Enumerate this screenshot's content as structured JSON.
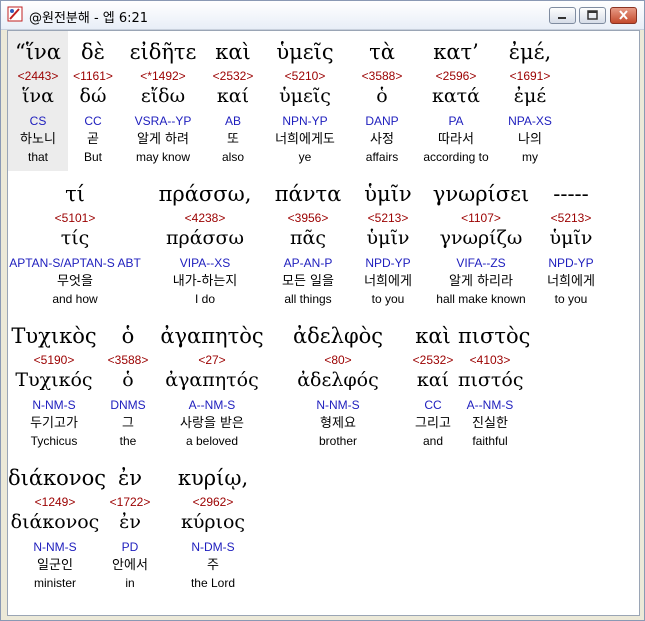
{
  "window": {
    "title": "@원전분해 - 엡 6:21",
    "buttons": {
      "minimize": "minimize",
      "maximize": "maximize",
      "close": "close"
    }
  },
  "rows": [
    [
      {
        "surface": "“ἵνα",
        "strong": "<2443>",
        "lemma": "ἵνα",
        "parse": "CS",
        "korean": "하노니",
        "english": "that",
        "selected": true
      },
      {
        "surface": "δὲ",
        "strong": "<1161>",
        "lemma": "δώ",
        "parse": "CC",
        "korean": "곧",
        "english": "But"
      },
      {
        "surface": "εἰδῆτε",
        "strong": "<*1492>",
        "lemma": "εἴδω",
        "parse": "VSRA--YP",
        "korean": "알게 하려",
        "english": "may know"
      },
      {
        "surface": "καὶ",
        "strong": "<2532>",
        "lemma": "καί",
        "parse": "AB",
        "korean": "또",
        "english": "also"
      },
      {
        "surface": "ὑμεῖς",
        "strong": "<5210>",
        "lemma": "ὑμεῖς",
        "parse": "NPN-YP",
        "korean": "너희에게도",
        "english": "ye"
      },
      {
        "surface": "τὰ",
        "strong": "<3588>",
        "lemma": "ὁ",
        "parse": "DANP",
        "korean": "사정",
        "english": "affairs"
      },
      {
        "surface": "κατ’",
        "strong": "<2596>",
        "lemma": "κατά",
        "parse": "PA",
        "korean": "따라서",
        "english": "according to"
      },
      {
        "surface": "ἐμέ,",
        "strong": "<1691>",
        "lemma": "ἐμέ",
        "parse": "NPA-XS",
        "korean": "나의",
        "english": "my"
      }
    ],
    [
      {
        "surface": "τί",
        "strong": "<5101>",
        "lemma": "τίς",
        "parse": "APTAN-S/APTAN-S ABT",
        "korean": "무엇을",
        "english": "and how"
      },
      {
        "surface": "πράσσω,",
        "strong": "<4238>",
        "lemma": "πράσσω",
        "parse": "VIPA--XS",
        "korean": "내가-하는지",
        "english": "I do"
      },
      {
        "surface": "πάντα",
        "strong": "<3956>",
        "lemma": "πᾶς",
        "parse": "AP-AN-P",
        "korean": "모든 일을",
        "english": "all things"
      },
      {
        "surface": "ὑμῖν",
        "strong": "<5213>",
        "lemma": "ὑμῖν",
        "parse": "NPD-YP",
        "korean": "너희에게",
        "english": "to you"
      },
      {
        "surface": "γνωρίσει",
        "strong": "<1107>",
        "lemma": "γνωρίζω",
        "parse": "VIFA--ZS",
        "korean": "알게 하리라",
        "english": "hall make known"
      },
      {
        "surface": "-----",
        "strong": "<5213>",
        "lemma": "ὑμῖν",
        "parse": "NPD-YP",
        "korean": "너희에게",
        "english": "to you"
      }
    ],
    [
      {
        "surface": "Τυχικὸς",
        "strong": "<5190>",
        "lemma": "Τυχικός",
        "parse": "N-NM-S",
        "korean": "두기고가",
        "english": "Tychicus"
      },
      {
        "surface": "ὁ",
        "strong": "<3588>",
        "lemma": "ὁ",
        "parse": "DNMS",
        "korean": "그",
        "english": "the"
      },
      {
        "surface": "ἀγαπητὸς",
        "strong": "<27>",
        "lemma": "ἀγαπητός",
        "parse": "A--NM-S",
        "korean": "사랑을 받은",
        "english": "a beloved"
      },
      {
        "surface": "ἀδελφὸς",
        "strong": "<80>",
        "lemma": "ἀδελφός",
        "parse": "N-NM-S",
        "korean": "형제요",
        "english": "brother"
      },
      {
        "surface": "καὶ",
        "strong": "<2532>",
        "lemma": "καί",
        "parse": "CC",
        "korean": "그리고",
        "english": "and"
      },
      {
        "surface": "πιστὸς",
        "strong": "<4103>",
        "lemma": "πιστός",
        "parse": "A--NM-S",
        "korean": "진실한",
        "english": "faithful"
      }
    ],
    [
      {
        "surface": "διάκονος",
        "strong": "<1249>",
        "lemma": "διάκονος",
        "parse": "N-NM-S",
        "korean": "일군인",
        "english": "minister"
      },
      {
        "surface": "ἐν",
        "strong": "<1722>",
        "lemma": "ἐν",
        "parse": "PD",
        "korean": "안에서",
        "english": "in"
      },
      {
        "surface": "κυρίῳ,",
        "strong": "<2962>",
        "lemma": "κύριος",
        "parse": "N-DM-S",
        "korean": "주",
        "english": "the Lord"
      }
    ]
  ]
}
